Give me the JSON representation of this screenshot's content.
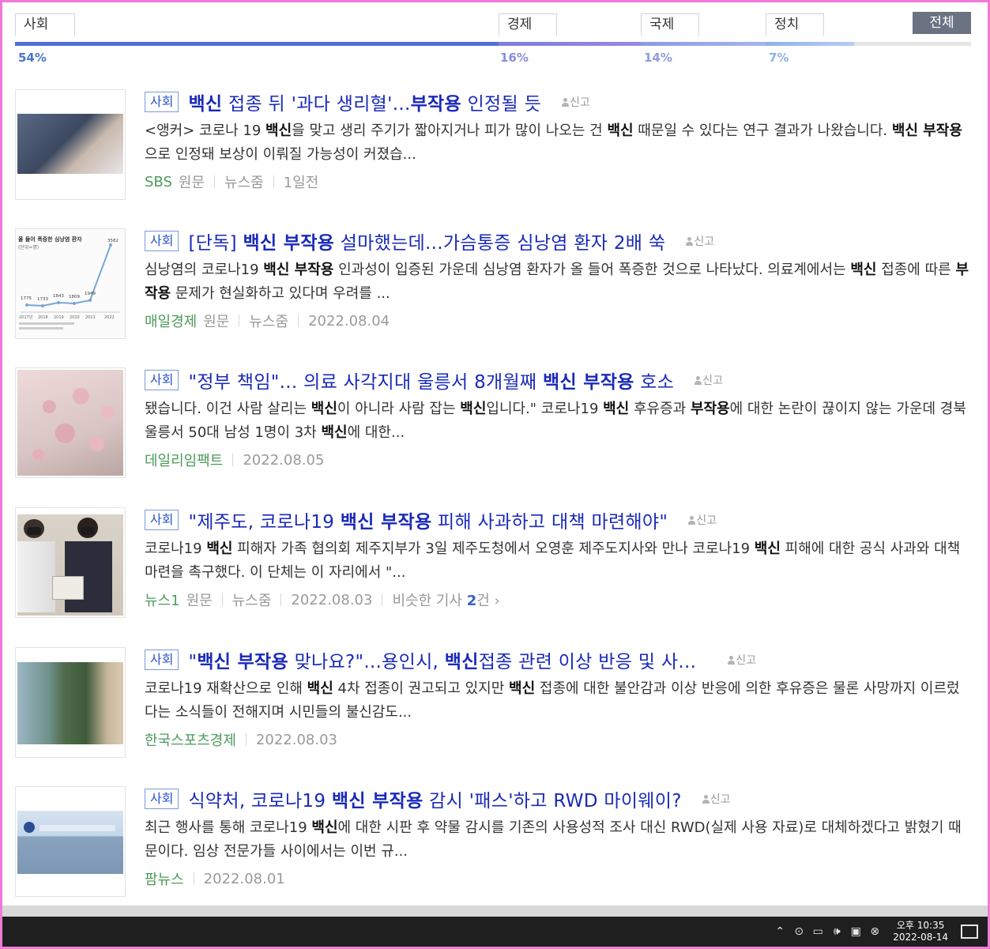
{
  "categories": {
    "tabs": [
      {
        "label": "사회",
        "pct": "54%"
      },
      {
        "label": "경제",
        "pct": "16%"
      },
      {
        "label": "국제",
        "pct": "14%"
      },
      {
        "label": "정치",
        "pct": "7%"
      }
    ],
    "all_label": "전체"
  },
  "report_label": "신고",
  "articles": [
    {
      "category": "사회",
      "title_parts": [
        [
          "b",
          "백신"
        ],
        [
          "",
          " 접종 뒤 '과다 생리혈'..."
        ],
        [
          "b",
          "부작용"
        ],
        [
          "",
          " 인정될 듯"
        ]
      ],
      "summary_parts": [
        [
          "",
          "<앵커> 코로나 19 "
        ],
        [
          "b",
          "백신"
        ],
        [
          "",
          "을 맞고 생리 주기가 짧아지거나 피가 많이 나오는 건 "
        ],
        [
          "b",
          "백신"
        ],
        [
          "",
          " 때문일 수 있다는 연구 결과가 나왔습니다. "
        ],
        [
          "b",
          "백신 부작용"
        ],
        [
          "",
          "으로 인정돼 보상이 이뤄질 가능성이 커졌습..."
        ]
      ],
      "press": "SBS",
      "meta": [
        "원문",
        "뉴스줌",
        "1일전"
      ]
    },
    {
      "category": "사회",
      "title_parts": [
        [
          "",
          "[단독] "
        ],
        [
          "b",
          "백신 부작용"
        ],
        [
          "",
          " 설마했는데...가슴통증 심낭염 환자 2배 쑥"
        ]
      ],
      "summary_parts": [
        [
          "",
          "심낭염의 코로나19 "
        ],
        [
          "b",
          "백신 부작용"
        ],
        [
          "",
          " 인과성이 입증된 가운데 심낭염 환자가 올 들어 폭증한 것으로 나타났다. 의료계에서는 "
        ],
        [
          "b",
          "백신"
        ],
        [
          "",
          " 접종에 따른 "
        ],
        [
          "b",
          "부작용"
        ],
        [
          "",
          " 문제가 현실화하고 있다며 우려를 ..."
        ]
      ],
      "press": "매일경제",
      "meta": [
        "원문",
        "뉴스줌",
        "2022.08.04"
      ]
    },
    {
      "category": "사회",
      "title_parts": [
        [
          "",
          "\"정부 책임\"... 의료 사각지대 울릉서 8개월째 "
        ],
        [
          "b",
          "백신 부작용"
        ],
        [
          "",
          " 호소"
        ]
      ],
      "summary_parts": [
        [
          "",
          "됐습니다. 이건 사람 살리는 "
        ],
        [
          "b",
          "백신"
        ],
        [
          "",
          "이 아니라 사람 잡는 "
        ],
        [
          "b",
          "백신"
        ],
        [
          "",
          "입니다.\" 코로나19 "
        ],
        [
          "b",
          "백신"
        ],
        [
          "",
          " 후유증과 "
        ],
        [
          "b",
          "부작용"
        ],
        [
          "",
          "에 대한 논란이 끊이지 않는 가운데 경북 울릉서 50대 남성 1명이 3차 "
        ],
        [
          "b",
          "백신"
        ],
        [
          "",
          "에 대한..."
        ]
      ],
      "press": "데일리임팩트",
      "meta": [
        "2022.08.05"
      ]
    },
    {
      "category": "사회",
      "title_parts": [
        [
          "",
          "\"제주도, 코로나19 "
        ],
        [
          "b",
          "백신 부작용"
        ],
        [
          "",
          " 피해 사과하고 대책 마련해야\""
        ]
      ],
      "summary_parts": [
        [
          "",
          "코로나19 "
        ],
        [
          "b",
          "백신"
        ],
        [
          "",
          " 피해자 가족 협의회 제주지부가 3일 제주도청에서 오영훈 제주도지사와 만나 코로나19 "
        ],
        [
          "b",
          "백신"
        ],
        [
          "",
          " 피해에 대한 공식 사과와 대책 마련을 촉구했다. 이 단체는 이 자리에서 \"..."
        ]
      ],
      "press": "뉴스1",
      "meta": [
        "원문",
        "뉴스줌",
        "2022.08.03"
      ],
      "similar": {
        "prefix": "비슷한 기사 ",
        "count": "2",
        "suffix": "건 ›"
      }
    },
    {
      "category": "사회",
      "title_parts": [
        [
          "",
          "\""
        ],
        [
          "b",
          "백신 부작용"
        ],
        [
          "",
          " 맞나요?\"...용인시, "
        ],
        [
          "b",
          "백신"
        ],
        [
          "",
          "접종 관련 이상 반응 및 사..."
        ]
      ],
      "summary_parts": [
        [
          "",
          "코로나19 재확산으로 인해 "
        ],
        [
          "b",
          "백신"
        ],
        [
          "",
          " 4차 접종이 권고되고 있지만 "
        ],
        [
          "b",
          "백신"
        ],
        [
          "",
          " 접종에 대한 불안감과 이상 반응에 의한 후유증은 물론 사망까지 이르렀다는 소식들이 전해지며 시민들의 불신감도..."
        ]
      ],
      "press": "한국스포츠경제",
      "meta": [
        "2022.08.03"
      ]
    },
    {
      "category": "사회",
      "title_parts": [
        [
          "",
          "식약처, 코로나19 "
        ],
        [
          "b",
          "백신 부작용"
        ],
        [
          "",
          " 감시 '패스'하고 RWD 마이웨이?"
        ]
      ],
      "summary_parts": [
        [
          "",
          "최근 행사를 통해 코로나19 "
        ],
        [
          "b",
          "백신"
        ],
        [
          "",
          "에 대한 시판 후 약물 감시를 기존의 사용성적 조사 대신 RWD(실제 사용 자료)로 대체하겠다고 밝혔기 때문이다. 임상 전문가들 사이에서는 이번 규..."
        ]
      ],
      "press": "팜뉴스",
      "meta": [
        "2022.08.01"
      ]
    }
  ],
  "thumb2_chart": {
    "title": "올 들어 폭증한 심낭염 환자",
    "unit": "(단위=명)",
    "values": [
      "1775",
      "1733",
      "1843",
      "1809",
      "1949",
      "3582"
    ],
    "years": [
      "2017년",
      "2018",
      "2019",
      "2020",
      "2021",
      "2022"
    ]
  },
  "taskbar": {
    "time": "오후 10:35",
    "date": "2022-08-14"
  }
}
